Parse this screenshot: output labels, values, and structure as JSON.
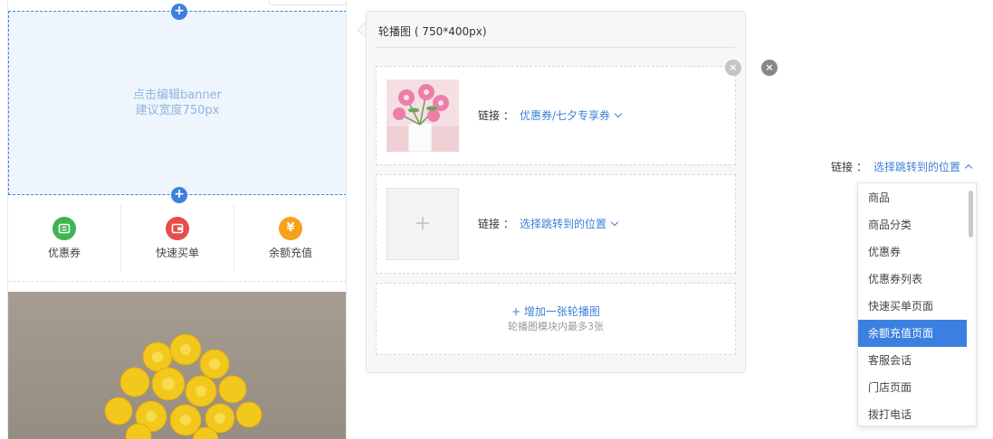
{
  "preview": {
    "banner_line1": "点击编辑banner",
    "banner_line2": "建议宽度750px",
    "add_symbol": "+",
    "nav_items": [
      {
        "label": "优惠券",
        "icon": "coupon-icon",
        "color": "#3fb452"
      },
      {
        "label": "快速买单",
        "icon": "wallet-icon",
        "color": "#e84c4c"
      },
      {
        "label": "余额充值",
        "icon": "yen-icon",
        "color": "#f5a11d"
      }
    ]
  },
  "panel": {
    "title": "轮播图 ( 750*400px)",
    "slides": [
      {
        "link_label": "链接 ：",
        "link_value": "优惠券/七夕专享券"
      },
      {
        "link_label": "链接 ：",
        "link_value": "选择跳转到的位置",
        "placeholder_symbol": "+"
      }
    ],
    "add_label": "+ 增加一张轮播图",
    "add_hint": "轮播图模块内最多3张",
    "close_symbol": "×"
  },
  "link_picker": {
    "label": "链接 ：",
    "value": "选择跳转到的位置",
    "options": [
      "商品",
      "商品分类",
      "优惠券",
      "优惠券列表",
      "快速买单页面",
      "余额充值页面",
      "客服会话",
      "门店页面",
      "拨打电话"
    ],
    "selected": "余额充值页面"
  },
  "colors": {
    "accent": "#3d7fd8",
    "selected_bg": "#3b80e0"
  }
}
